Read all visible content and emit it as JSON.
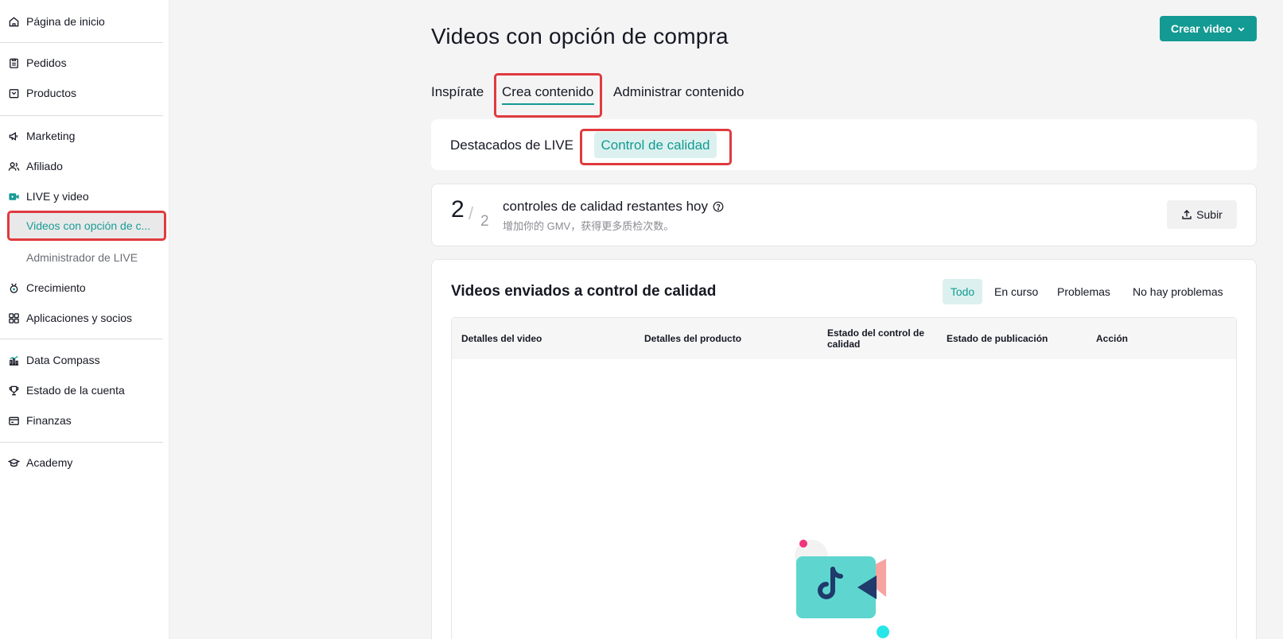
{
  "sidebar": {
    "items": [
      {
        "label": "Página de inicio",
        "icon": "home-icon"
      },
      {
        "label": "Pedidos",
        "icon": "clipboard-icon"
      },
      {
        "label": "Productos",
        "icon": "box-icon"
      },
      {
        "label": "Marketing",
        "icon": "megaphone-icon"
      },
      {
        "label": "Afiliado",
        "icon": "users-icon"
      },
      {
        "label": "LIVE y video",
        "icon": "video-icon"
      },
      {
        "label": "Videos con opción de c..."
      },
      {
        "label": "Administrador de LIVE"
      },
      {
        "label": "Crecimiento",
        "icon": "medal-icon"
      },
      {
        "label": "Aplicaciones y socios",
        "icon": "apps-icon"
      },
      {
        "label": "Data Compass",
        "icon": "chart-icon"
      },
      {
        "label": "Estado de la cuenta",
        "icon": "trophy-icon"
      },
      {
        "label": "Finanzas",
        "icon": "wallet-icon"
      },
      {
        "label": "Academy",
        "icon": "graduation-cap-icon"
      }
    ]
  },
  "header": {
    "title": "Videos con opción de compra",
    "create_button": "Crear video"
  },
  "tabs": [
    "Inspírate",
    "Crea contenido",
    "Administrar contenido"
  ],
  "subtabs": [
    "Destacados de LIVE",
    "Control de calidad"
  ],
  "quota": {
    "remaining": "2",
    "total": "2",
    "title": "controles de calidad restantes hoy",
    "subtitle": "增加你的 GMV，获得更多质检次数。",
    "upload_button": "Subir"
  },
  "list": {
    "title": "Videos enviados a control de calidad",
    "filters": [
      "Todo",
      "En curso",
      "Problemas",
      "No hay problemas"
    ],
    "columns": [
      "Detalles del video",
      "Detalles del producto",
      "Estado del control de calidad",
      "Estado de publicación",
      "Acción"
    ]
  },
  "colors": {
    "accent": "#139a93",
    "highlight": "#e03a3e"
  }
}
